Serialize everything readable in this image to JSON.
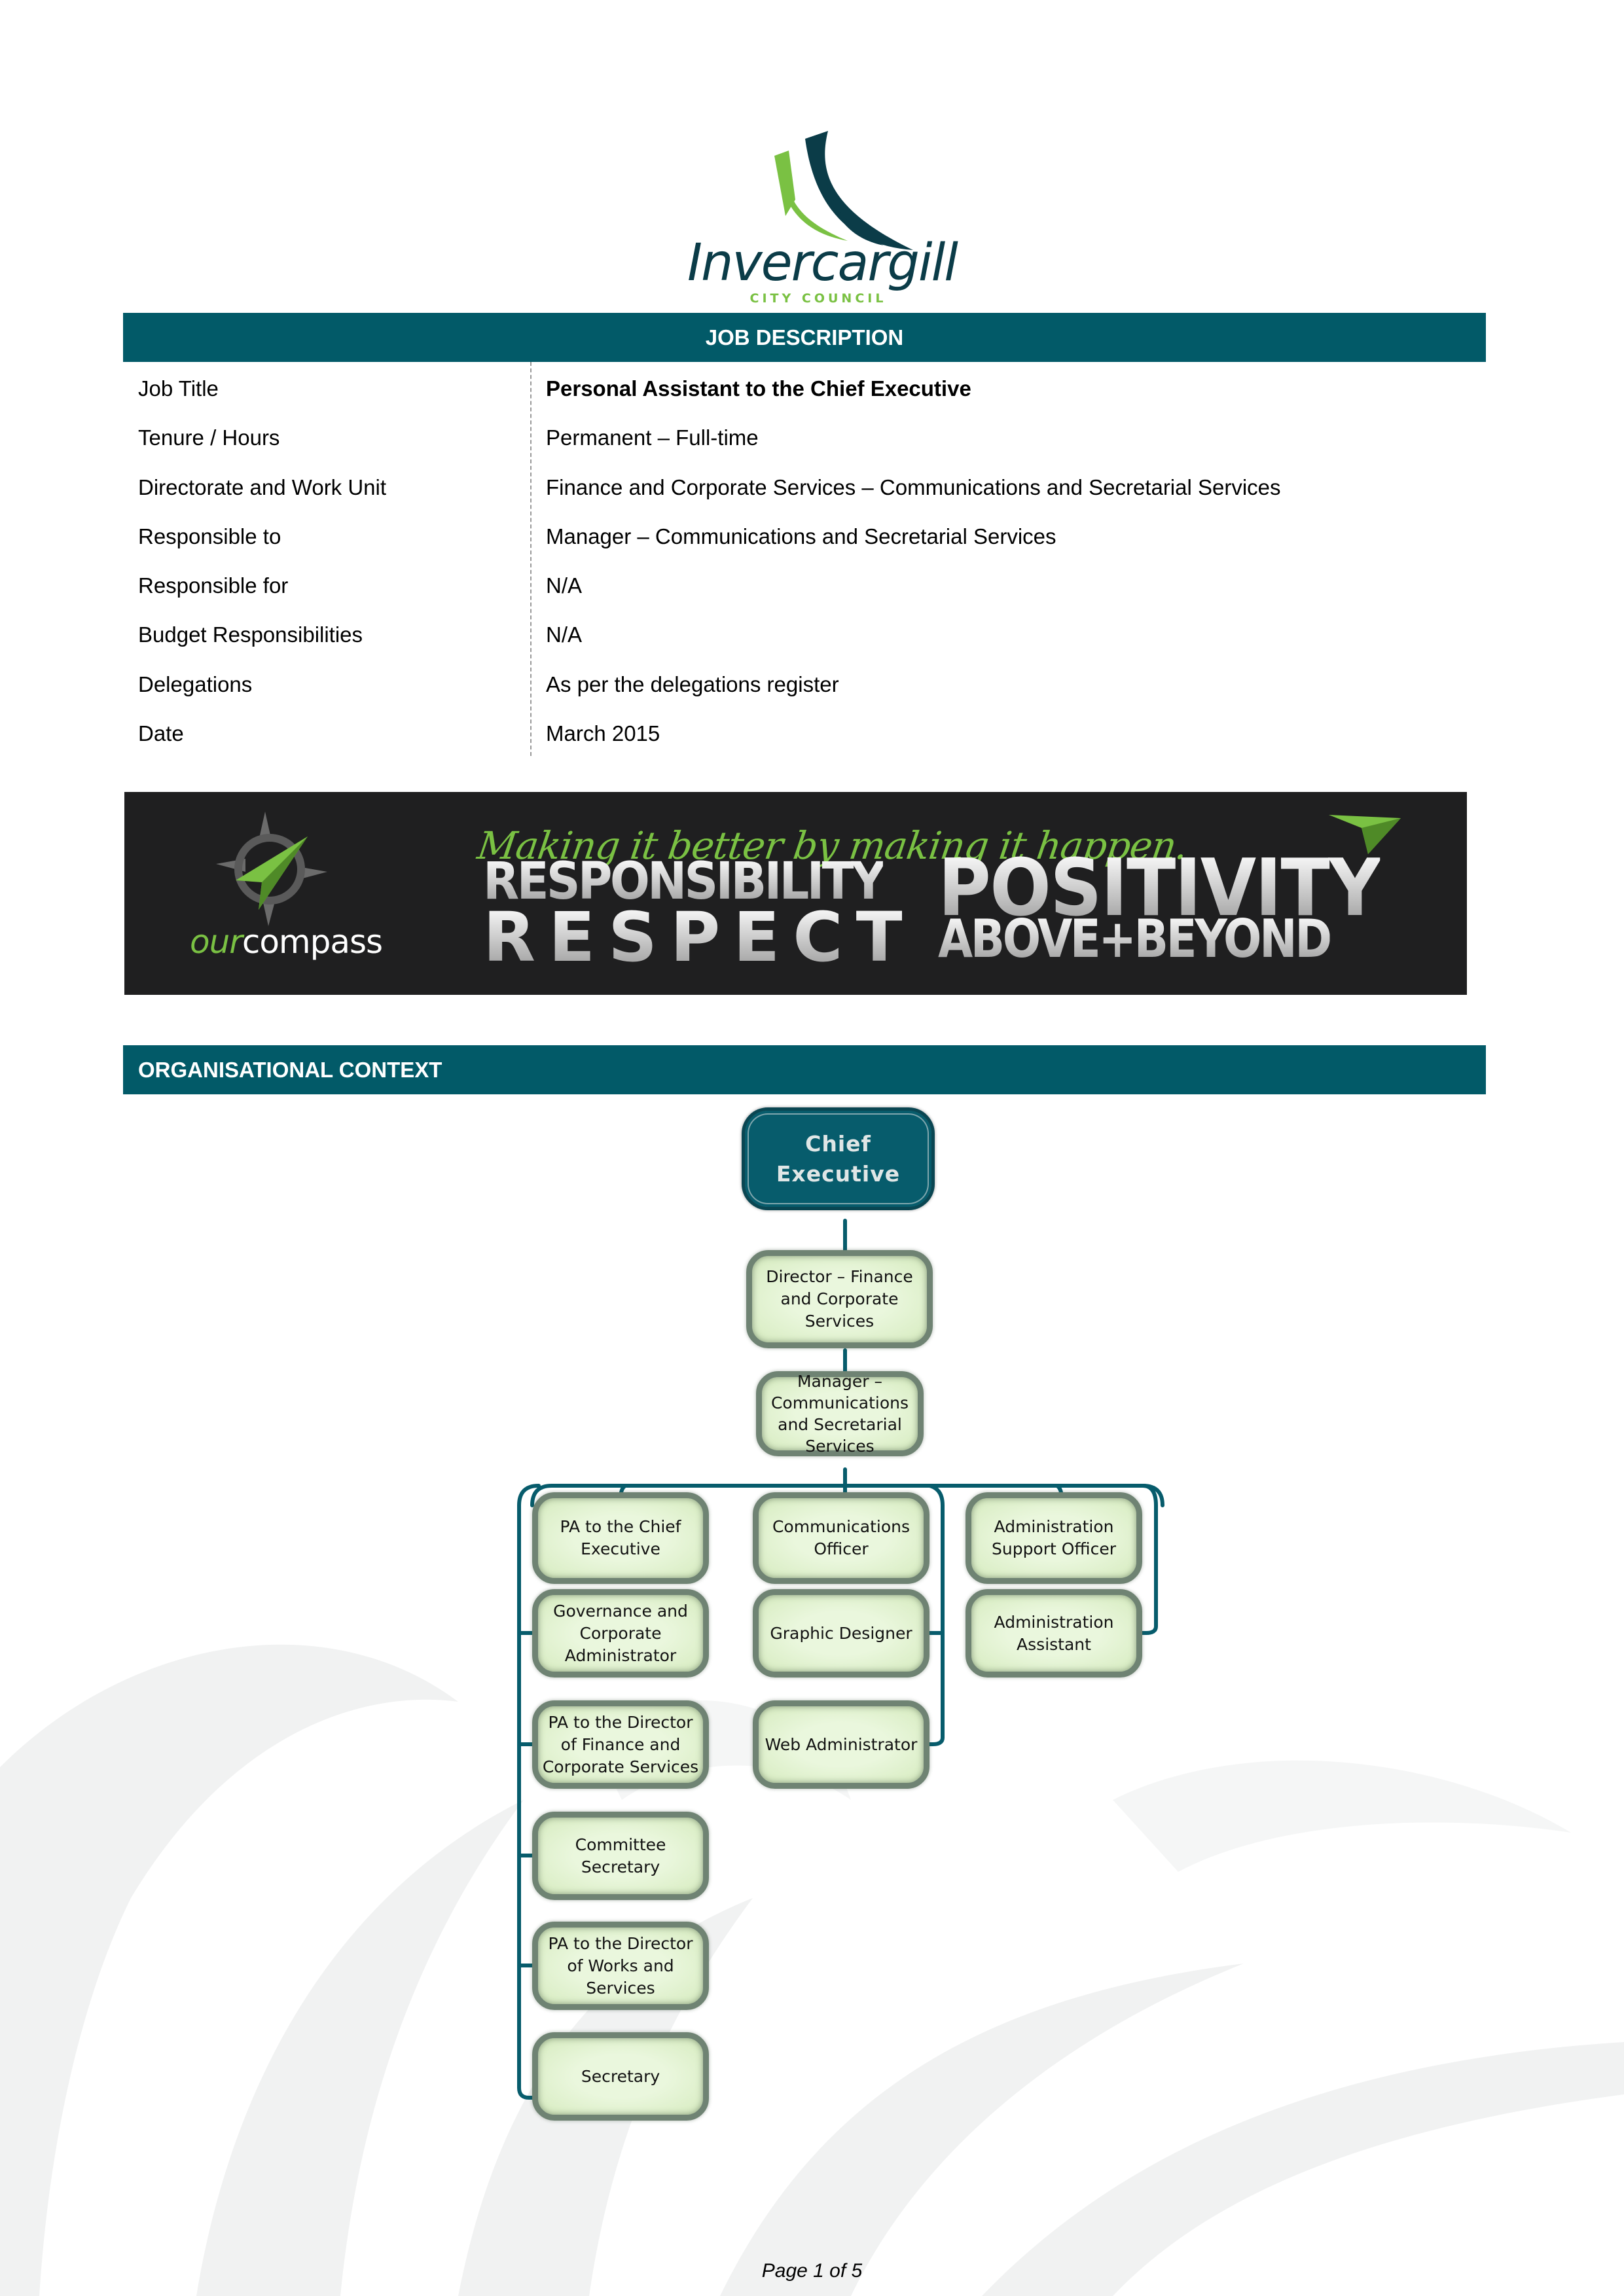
{
  "logo": {
    "wordmark": "Invercargill",
    "subtitle": "CITY COUNCIL",
    "colors": {
      "navy": "#0b3c48",
      "green": "#7ac143"
    }
  },
  "job_description": {
    "header": "JOB DESCRIPTION",
    "rows": [
      {
        "label": "Job Title",
        "value": "Personal Assistant to the Chief Executive",
        "bold": true
      },
      {
        "label": "Tenure / Hours",
        "value": "Permanent – Full-time"
      },
      {
        "label": "Directorate and Work Unit",
        "value": "Finance and Corporate Services – Communications and Secretarial Services"
      },
      {
        "label": "Responsible to",
        "value": "Manager – Communications and Secretarial Services"
      },
      {
        "label": "Responsible for",
        "value": "N/A"
      },
      {
        "label": "Budget Responsibilities",
        "value": "N/A"
      },
      {
        "label": "Delegations",
        "value": "As per the delegations register"
      },
      {
        "label": "Date",
        "value": "March 2015"
      }
    ]
  },
  "banner": {
    "brand_our": "our",
    "brand_compass": "compass",
    "tagline": "Making it better by making it happen.",
    "values": [
      "RESPONSIBILITY",
      "RESPECT",
      "POSITIVITY",
      "ABOVE+BEYOND"
    ]
  },
  "organisational_context": {
    "header": "ORGANISATIONAL CONTEXT",
    "nodes": {
      "ceo": [
        "Chief",
        "Executive"
      ],
      "director": [
        "Director – Finance",
        "and Corporate",
        "Services"
      ],
      "manager": [
        "Manager –",
        "Communications",
        "and Secretarial",
        "Services"
      ],
      "pa_ce": [
        "PA to the Chief",
        "Executive"
      ],
      "gov_admin": [
        "Governance and",
        "Corporate",
        "Administrator"
      ],
      "pa_dfcs": [
        "PA to the Director",
        "of Finance and",
        "Corporate Services"
      ],
      "committee_sec": [
        "Committee",
        "Secretary"
      ],
      "pa_dws": [
        "PA to the Director",
        "of Works and",
        "Services"
      ],
      "secretary": [
        "Secretary"
      ],
      "comms_officer": [
        "Communications",
        "Officer"
      ],
      "graphic_designer": [
        "Graphic Designer"
      ],
      "web_admin": [
        "Web Administrator"
      ],
      "admin_support": [
        "Administration",
        "Support Officer"
      ],
      "admin_assistant": [
        "Administration",
        "Assistant"
      ]
    },
    "colors": {
      "line": "#075c6c",
      "node_fill": "#e2f3d2",
      "node_border": "#6f8373"
    }
  },
  "footer": {
    "page": "Page 1 of 5"
  }
}
